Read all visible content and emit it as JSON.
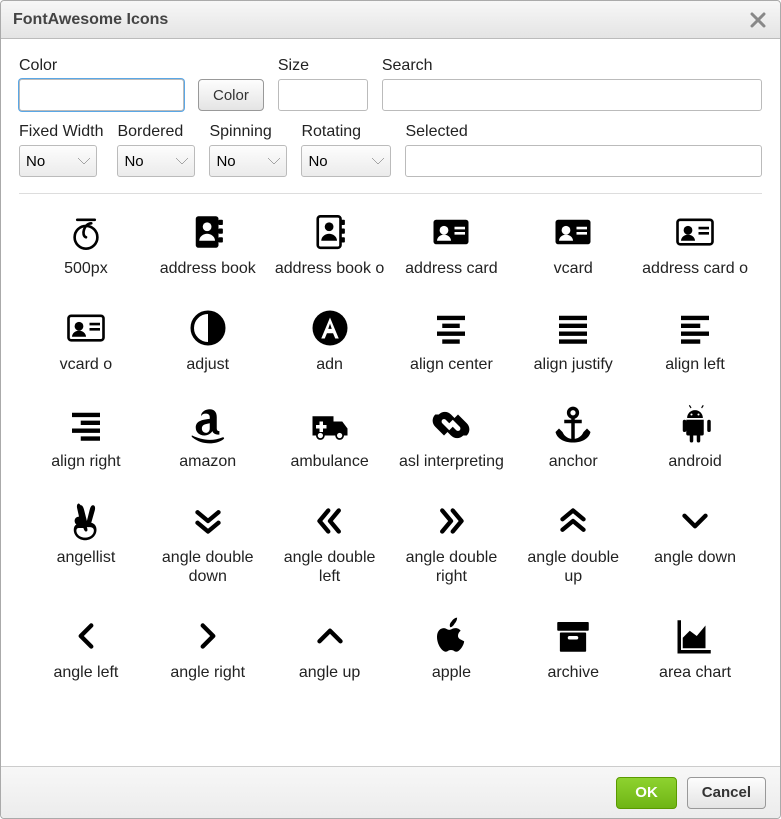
{
  "dialog": {
    "title": "FontAwesome Icons"
  },
  "labels": {
    "color": "Color",
    "size": "Size",
    "search": "Search",
    "fixed_width": "Fixed Width",
    "bordered": "Bordered",
    "spinning": "Spinning",
    "rotating": "Rotating",
    "selected": "Selected",
    "color_button": "Color"
  },
  "inputs": {
    "color": "",
    "size": "",
    "search": "",
    "selected": ""
  },
  "dropdowns": {
    "fixed_width": "No",
    "bordered": "No",
    "spinning": "No",
    "rotating": "No"
  },
  "buttons": {
    "ok": "OK",
    "cancel": "Cancel"
  },
  "icons": [
    {
      "name": "500px",
      "label": "500px"
    },
    {
      "name": "address-book",
      "label": "address book"
    },
    {
      "name": "address-book-o",
      "label": "address book o"
    },
    {
      "name": "address-card",
      "label": "address card"
    },
    {
      "name": "vcard",
      "label": "vcard"
    },
    {
      "name": "address-card-o",
      "label": "address card o"
    },
    {
      "name": "vcard-o",
      "label": "vcard o"
    },
    {
      "name": "adjust",
      "label": "adjust"
    },
    {
      "name": "adn",
      "label": "adn"
    },
    {
      "name": "align-center",
      "label": "align center"
    },
    {
      "name": "align-justify",
      "label": "align justify"
    },
    {
      "name": "align-left",
      "label": "align left"
    },
    {
      "name": "align-right",
      "label": "align right"
    },
    {
      "name": "amazon",
      "label": "amazon"
    },
    {
      "name": "ambulance",
      "label": "ambulance"
    },
    {
      "name": "asl-interpreting",
      "label": "asl interpreting"
    },
    {
      "name": "anchor",
      "label": "anchor"
    },
    {
      "name": "android",
      "label": "android"
    },
    {
      "name": "angellist",
      "label": "angellist"
    },
    {
      "name": "angle-double-down",
      "label": "angle double down"
    },
    {
      "name": "angle-double-left",
      "label": "angle double left"
    },
    {
      "name": "angle-double-right",
      "label": "angle double right"
    },
    {
      "name": "angle-double-up",
      "label": "angle double up"
    },
    {
      "name": "angle-down",
      "label": "angle down"
    },
    {
      "name": "angle-left",
      "label": "angle left"
    },
    {
      "name": "angle-right",
      "label": "angle right"
    },
    {
      "name": "angle-up",
      "label": "angle up"
    },
    {
      "name": "apple",
      "label": "apple"
    },
    {
      "name": "archive",
      "label": "archive"
    },
    {
      "name": "area-chart",
      "label": "area chart"
    }
  ]
}
